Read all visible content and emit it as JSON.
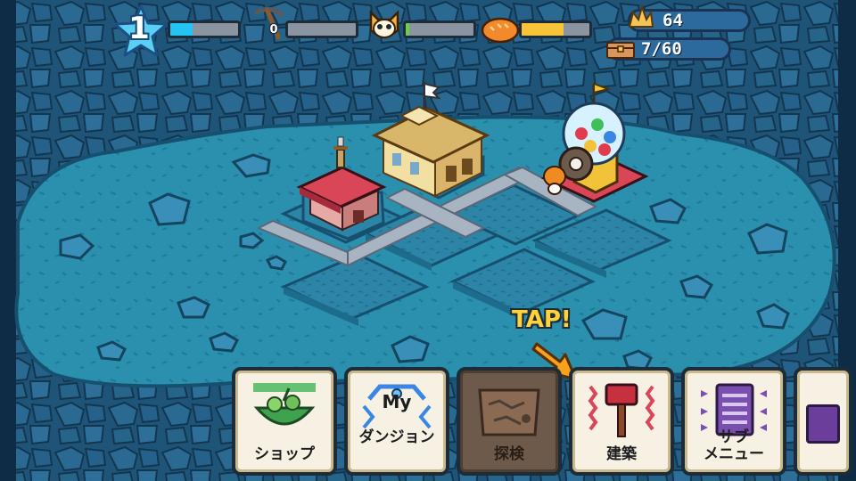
{
  "hud": {
    "level": "1",
    "exp_fraction": 0.33,
    "pickaxe_count": "0",
    "pickaxe_fraction": 0.0,
    "monster_fraction": 0.05,
    "food_fraction": 0.62,
    "crystal_count": "64",
    "storage": "7/60"
  },
  "hint": {
    "tap_text": "TAP!"
  },
  "menu": {
    "shop": "ショップ",
    "my_dungeon_top": "My",
    "my_dungeon": "ダンジョン",
    "explore": "探検",
    "build": "建築",
    "submenu": "サブ\nメニュー"
  },
  "colors": {
    "exp_bar": "#24c3f2",
    "pickaxe_bar": "#8b95a1",
    "monster_bar": "#6ad147",
    "food_bar": "#f7c338"
  },
  "icons": [
    "star-level-icon",
    "pickaxe-icon",
    "monster-face-icon",
    "bread-icon",
    "crystal-icon",
    "treasure-chest-icon",
    "vegetable-basket-icon",
    "shield-crest-icon",
    "explore-map-icon",
    "hammer-icon",
    "list-menu-icon",
    "arrow-pointer-icon"
  ]
}
